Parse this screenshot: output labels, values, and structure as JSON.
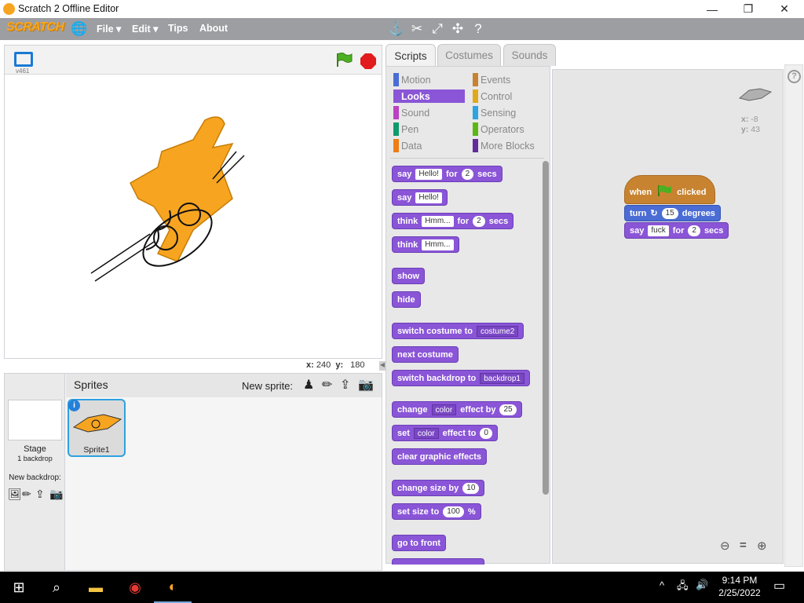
{
  "window": {
    "title": "Scratch 2 Offline Editor",
    "min": "—",
    "max": "❐",
    "close": "✕"
  },
  "menu": {
    "logo": "SCRATCH",
    "file": "File ▾",
    "edit": "Edit ▾",
    "tips": "Tips",
    "about": "About"
  },
  "stage": {
    "version": "v461",
    "coord_x_label": "x:",
    "coord_x": "240",
    "coord_y_label": "y:",
    "coord_y": "180"
  },
  "sprites": {
    "header": "Sprites",
    "new_sprite": "New sprite:",
    "stage_label": "Stage",
    "stage_sub": "1 backdrop",
    "new_backdrop": "New backdrop:",
    "sprite1": "Sprite1"
  },
  "tabs": {
    "scripts": "Scripts",
    "costumes": "Costumes",
    "sounds": "Sounds"
  },
  "categories": {
    "motion": "Motion",
    "looks": "Looks",
    "sound": "Sound",
    "pen": "Pen",
    "data": "Data",
    "events": "Events",
    "control": "Control",
    "sensing": "Sensing",
    "operators": "Operators",
    "more": "More Blocks"
  },
  "blocks": {
    "say": "say",
    "for": "for",
    "secs": "secs",
    "hello": "Hello!",
    "two": "2",
    "think": "think",
    "hmm": "Hmm...",
    "show": "show",
    "hide": "hide",
    "switch_costume": "switch costume to",
    "costume2": "costume2",
    "next_costume": "next costume",
    "switch_backdrop": "switch backdrop to",
    "backdrop1": "backdrop1",
    "change": "change",
    "color": "color",
    "effect_by": "effect by",
    "twentyfive": "25",
    "set": "set",
    "effect_to": "effect to",
    "zero": "0",
    "clear_effects": "clear graphic effects",
    "change_size": "change size by",
    "ten": "10",
    "set_size": "set size to",
    "hundred": "100",
    "pct": "%",
    "go_front": "go to front"
  },
  "script": {
    "when": "when",
    "clicked": "clicked",
    "turn": "turn",
    "fifteen": "15",
    "degrees": "degrees",
    "say": "say",
    "word": "fuck",
    "for": "for",
    "two": "2",
    "secs": "secs",
    "x_label": "x:",
    "x": "-8",
    "y_label": "y:",
    "y": "43"
  },
  "taskbar": {
    "time": "9:14 PM",
    "date": "2/25/2022"
  },
  "colors": {
    "looks": "#8a55d7",
    "motion": "#4a6cd4",
    "events": "#c88330",
    "control": "#e1a91a",
    "sound": "#bb42c3",
    "sensing": "#2ca5e2",
    "pen": "#0e9a6c",
    "operators": "#5cb712",
    "data": "#ee7d16",
    "more": "#632d99"
  }
}
